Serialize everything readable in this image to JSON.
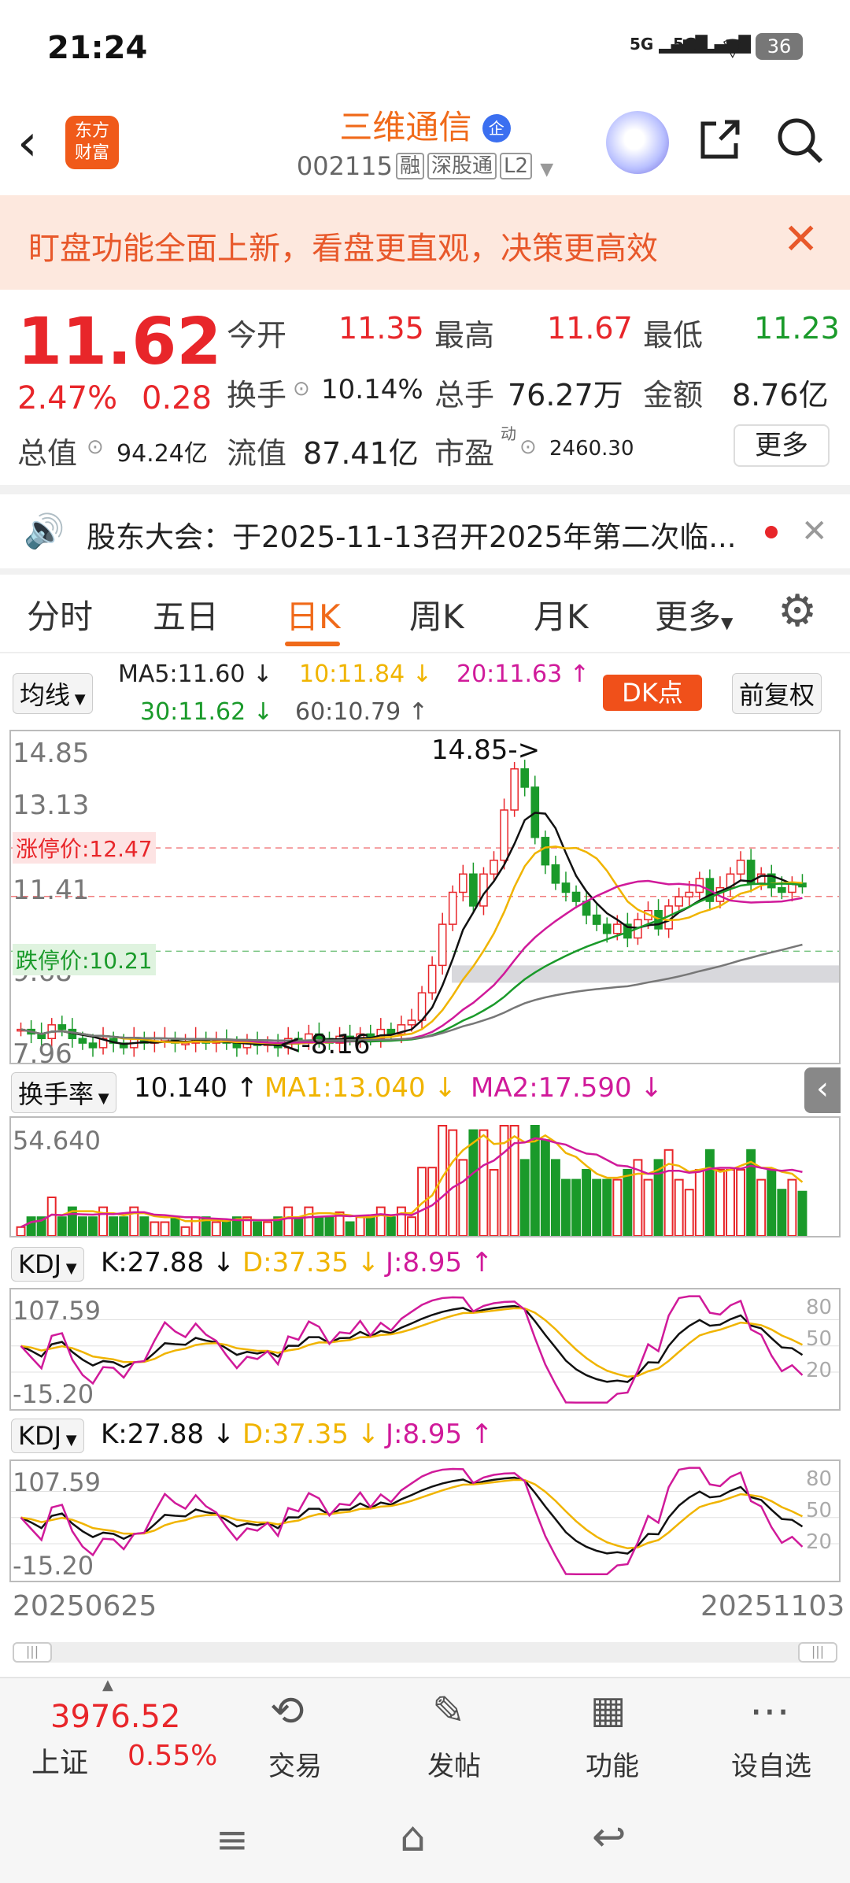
{
  "status_bar": {
    "time": "21:24",
    "signal1": "5G",
    "signal2": "5G",
    "battery": "36"
  },
  "header": {
    "logo_line1": "东方",
    "logo_line2": "财富",
    "stock_name": "三维通信",
    "badge": "企",
    "code": "002115",
    "tags": [
      "融",
      "深股通",
      "L2"
    ]
  },
  "banner": {
    "text": "盯盘功能全面上新，看盘更直观，决策更高效"
  },
  "quote": {
    "price": "11.62",
    "change_pct": "2.47%",
    "change": "0.28",
    "open_label": "今开",
    "open": "11.35",
    "high_label": "最高",
    "high": "11.67",
    "low_label": "最低",
    "low": "11.23",
    "turnover_label": "换手",
    "turnover": "10.14%",
    "volume_label": "总手",
    "volume": "76.27万",
    "amount_label": "金额",
    "amount": "8.76亿",
    "mktcap_label": "总值",
    "mktcap": "94.24亿",
    "float_label": "流值",
    "float_cap": "87.41亿",
    "pe_label": "市盈",
    "pe_sup": "动",
    "pe": "2460.30",
    "more": "更多"
  },
  "notice": {
    "text": "股东大会：于2025-11-13召开2025年第二次临..."
  },
  "tabs": [
    "分时",
    "五日",
    "日K",
    "周K",
    "月K",
    "更多"
  ],
  "active_tab": "日K",
  "ma_panel": {
    "selector": "均线",
    "ma5": "MA5:11.60 ↓",
    "ma10": "10:11.84 ↓",
    "ma20": "20:11.63 ↑",
    "ma30": "30:11.62 ↓",
    "ma60": "60:10.79 ↑",
    "dk": "DK点",
    "adjust": "前复权"
  },
  "chart_data": [
    {
      "type": "candlestick",
      "y_ticks": [
        "14.85",
        "13.13",
        "11.41",
        "9.68",
        "7.96"
      ],
      "limit_up": "涨停价:12.47",
      "limit_down": "跌停价:10.21",
      "max_marker": "14.85->",
      "min_marker": "<-8.16",
      "x_start": "20250625",
      "x_end": "20251103",
      "series_labels": [
        "MA5",
        "MA10",
        "MA20",
        "MA30",
        "MA60"
      ],
      "closes": [
        8.5,
        8.4,
        8.3,
        8.6,
        8.5,
        8.3,
        8.2,
        8.1,
        8.3,
        8.2,
        8.1,
        8.3,
        8.2,
        8.25,
        8.3,
        8.2,
        8.2,
        8.3,
        8.2,
        8.25,
        8.2,
        8.1,
        8.2,
        8.15,
        8.2,
        8.1,
        8.3,
        8.2,
        8.4,
        8.3,
        8.2,
        8.35,
        8.3,
        8.4,
        8.3,
        8.5,
        8.4,
        8.6,
        8.7,
        9.3,
        9.9,
        10.8,
        11.5,
        11.9,
        11.2,
        11.9,
        12.2,
        13.3,
        14.2,
        13.8,
        12.7,
        12.1,
        11.7,
        11.5,
        11.3,
        11.0,
        10.8,
        10.6,
        10.8,
        10.5,
        10.9,
        11.1,
        10.7,
        11.2,
        11.4,
        11.5,
        11.8,
        11.3,
        11.6,
        11.9,
        12.2,
        11.7,
        11.9,
        11.6,
        11.5,
        11.7,
        11.62
      ]
    },
    {
      "type": "bar",
      "indicator": "换手率",
      "value": "10.140 ↑",
      "ma1": "MA1:13.040 ↓",
      "ma2": "MA2:17.590 ↓",
      "y_top": "54.640"
    },
    {
      "type": "line",
      "indicator": "KDJ",
      "k": "K:27.88 ↓",
      "d": "D:37.35 ↓",
      "j": "J:8.95 ↑",
      "y_max": "107.59",
      "y_min": "-15.20",
      "levels": [
        "80",
        "50",
        "20"
      ]
    },
    {
      "type": "line",
      "indicator": "KDJ",
      "k": "K:27.88 ↓",
      "d": "D:37.35 ↓",
      "j": "J:8.95 ↑",
      "y_max": "107.59",
      "y_min": "-15.20",
      "levels": [
        "80",
        "50",
        "20"
      ]
    }
  ],
  "bottom": {
    "index_value": "3976.52",
    "index_name": "上证",
    "index_change": "0.55%",
    "trade": "交易",
    "post": "发帖",
    "func": "功能",
    "watch": "设自选"
  },
  "colors": {
    "up": "#e8262a",
    "down": "#1a9a2a",
    "accent": "#f06a1a",
    "ma5": "#111111",
    "ma10": "#f0b400",
    "ma20": "#d01a9a",
    "ma30": "#1a9a2a",
    "ma60": "#777777"
  }
}
